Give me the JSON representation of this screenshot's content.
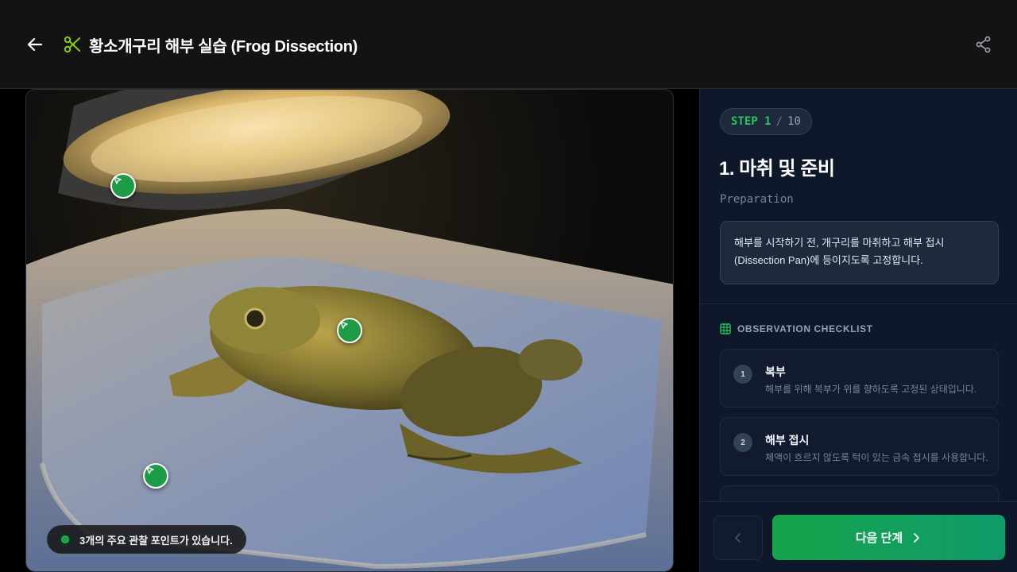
{
  "header": {
    "title": "황소개구리 해부 실습 (Frog Dissection)",
    "back_icon": "arrow-left-icon",
    "title_icon": "scissors-icon",
    "share_icon": "share-icon"
  },
  "image": {
    "hint_text": "3개의 주요 관찰 포인트가 있습니다.",
    "hotspot_icon": "cursor-arrow-icon",
    "hotspot_count": 3
  },
  "step": {
    "label": "STEP 1",
    "separator": "/",
    "total": "10",
    "title": "1. 마취 및 준비",
    "subtitle": "Preparation",
    "description": "해부를 시작하기 전, 개구리를 마취하고 해부 접시 (Dissection Pan)에 등이지도록 고정합니다."
  },
  "checklist": {
    "heading": "OBSERVATION CHECKLIST",
    "items": [
      {
        "num": "1",
        "title": "복부",
        "desc": "해부를 위해 복부가 위를 향하도록 고정된 상태입니다."
      },
      {
        "num": "2",
        "title": "해부 접시",
        "desc": "체액이 흐르지 않도록 턱이 있는 금속 접시를 사용합니다."
      }
    ]
  },
  "footer": {
    "next_label": "다음 단계"
  },
  "colors": {
    "accent": "#22c55e",
    "panel_bg": "#0f172a",
    "header_bg": "#131313"
  }
}
